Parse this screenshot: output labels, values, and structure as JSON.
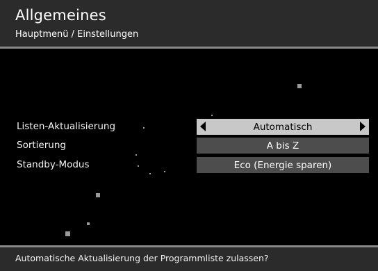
{
  "header": {
    "title": "Allgemeines",
    "breadcrumb": "Hauptmenü / Einstellungen"
  },
  "settings": [
    {
      "label": "Listen-Aktualisierung",
      "value": "Automatisch",
      "selected": true
    },
    {
      "label": "Sortierung",
      "value": "A bis Z",
      "selected": false
    },
    {
      "label": "Standby-Modus",
      "value": "Eco (Energie sparen)",
      "selected": false
    }
  ],
  "footer": {
    "hint": "Automatische Aktualisierung der Programmliste zulassen?"
  },
  "colors": {
    "background": "#000000",
    "bar": "#2b2b2b",
    "divider": "#8a8a8a",
    "selected_box": "#c8c8c8",
    "box": "#4d4d4d"
  }
}
